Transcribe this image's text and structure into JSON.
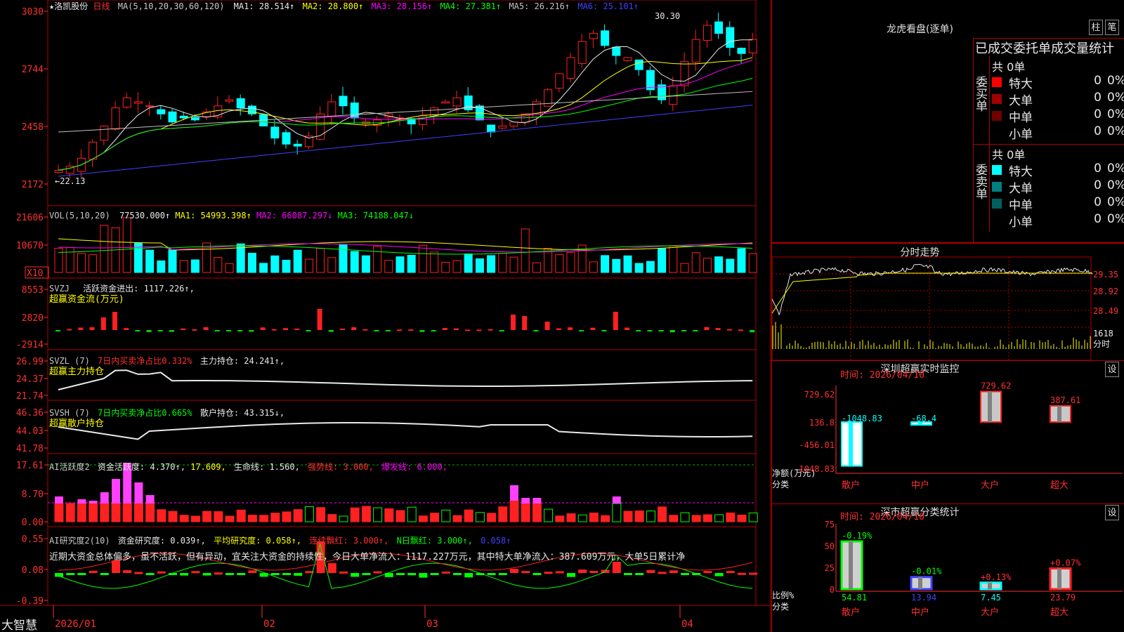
{
  "colors": {
    "up": "#ff2020",
    "down": "#00ffff",
    "grid": "#b00000",
    "axisText": "#ff3030"
  },
  "kline": {
    "name": "★洛凯股份",
    "period": "日线",
    "ma_spec": "MA(5,10,20,30,60,120)",
    "ma": [
      {
        "label": "MA1: 28.514↑",
        "color": "#e8e8e8"
      },
      {
        "label": "MA2: 28.800↑",
        "color": "#ffff00"
      },
      {
        "label": "MA3: 28.156↑",
        "color": "#ff00ff"
      },
      {
        "label": "MA4: 27.381↑",
        "color": "#00ff00"
      },
      {
        "label": "MA5: 26.216↑",
        "color": "#c0c0c0"
      },
      {
        "label": "MA6: 25.101↑",
        "color": "#4040ff"
      }
    ],
    "yticks": [
      "3030",
      "2744",
      "2458",
      "2172"
    ],
    "hi_label": "30.30",
    "lo_label": "←22.13"
  },
  "vol": {
    "title": "VOL(5,10,20)",
    "value": "77530.000↑",
    "ma": [
      {
        "label": "MA1: 54993.398↑",
        "color": "#ffff00"
      },
      {
        "label": "MA2: 66087.297↓",
        "color": "#ff00ff"
      },
      {
        "label": "MA3: 74188.047↓",
        "color": "#00ff00"
      }
    ],
    "yticks": [
      "21606",
      "10670"
    ],
    "unit": "X10"
  },
  "svzj": {
    "title": "SVZJ",
    "l1": "活跃资金进出: 1117.226↑,",
    "l2": "超赢资金流(万元)",
    "yticks": [
      "8553",
      "2820",
      "-2914"
    ]
  },
  "svzl": {
    "title": "SVZL (7)",
    "l1": "7日内买卖净占比0.332%",
    "l2": "主力持仓: 24.241↑,",
    "l3": "超赢主力持仓",
    "yticks": [
      "26.99",
      "24.37",
      "21.74"
    ]
  },
  "svsh": {
    "title": "SVSH (7)",
    "l1": "7日内买卖净占比0.665%",
    "l2": "散户持仓: 43.315↓,",
    "l3": "超赢散户持仓",
    "yticks": [
      "46.36",
      "44.03",
      "41.78"
    ]
  },
  "ai1": {
    "title": "AI活跃度2",
    "l1": "资金活跃度: 4.370↑,",
    "l2": "17.609,",
    "l3": "生命线: 1.560,",
    "l4": "强势线: 3.000,",
    "l5": "爆发线: 6.000,",
    "yticks": [
      "17.61",
      "8.70",
      "0.00"
    ]
  },
  "ai2": {
    "title": "AI研究度2(10)",
    "l1": "资金研究度: 0.039↑,",
    "l2": "平均研究度: 0.058↑,",
    "l3": "连续飘红: 3.000↑,",
    "l4": "N日飘红: 3.000↑,",
    "l5": "0.058↑",
    "comment": "近期大资金总体偏多，虽不活跃，但有异动，宜关注大资金的持续性，今日大单净流入：1117.227万元，其中特大单净流入：387.609万元，大单5日累计净",
    "yticks": [
      "0.55",
      "0.08",
      "-0.39"
    ]
  },
  "xaxis": {
    "labels": [
      "2026/01",
      "02",
      "03",
      "04"
    ],
    "brand": "大智慧"
  },
  "lhp": {
    "title": "龙虎看盘(逐单)",
    "btn1": "柱",
    "btn2": "笔",
    "subtitle": "已成交委托单成交量统计",
    "buy": {
      "label": "委买单",
      "total": "共 0单",
      "rows": [
        {
          "name": "特大",
          "count": "0",
          "pct": "0%",
          "color": "#ff0000"
        },
        {
          "name": "大单",
          "count": "0",
          "pct": "0%",
          "color": "#a00000"
        },
        {
          "name": "中单",
          "count": "0",
          "pct": "0%",
          "color": "#700000"
        },
        {
          "name": "小单",
          "count": "0",
          "pct": "0%",
          "color": "#000000"
        }
      ]
    },
    "sell": {
      "label": "委卖单",
      "total": "共 0单",
      "rows": [
        {
          "name": "特大",
          "count": "0",
          "pct": "0%",
          "color": "#00ffff"
        },
        {
          "name": "大单",
          "count": "0",
          "pct": "0%",
          "color": "#008080"
        },
        {
          "name": "中单",
          "count": "0",
          "pct": "0%",
          "color": "#006060"
        },
        {
          "name": "小单",
          "count": "0",
          "pct": "0%",
          "color": "#000000"
        }
      ]
    }
  },
  "intraday": {
    "title": "分时走势",
    "yticks": [
      "29.35",
      "28.92",
      "28.49"
    ],
    "vol_label": "1618",
    "vol_unit": "分时"
  },
  "monitor": {
    "title": "深圳超赢实时监控",
    "btn": "设",
    "time": "时间: 2026/04/10",
    "yticks": [
      "729.62",
      "136.8",
      "-456.01",
      "-1048.83"
    ],
    "ylabel": "净额(万元)",
    "xlabel": "分类",
    "bars": [
      {
        "cat": "散户",
        "value": -1048.83,
        "label": "-1048.83"
      },
      {
        "cat": "中户",
        "value": -68.4,
        "label": "-68.4"
      },
      {
        "cat": "大户",
        "value": 729.62,
        "label": "729.62"
      },
      {
        "cat": "超大",
        "value": 387.61,
        "label": "387.61"
      }
    ]
  },
  "classify": {
    "title": "深市超赢分类统计",
    "btn": "设",
    "time": "时间: 2026/04/10",
    "yticks": [
      "75",
      "50",
      "25",
      "0"
    ],
    "ylabel": "比例%",
    "xlabel": "分类",
    "bars": [
      {
        "cat": "散户",
        "value": 54.81,
        "chg": "-0.19%",
        "val": "54.81"
      },
      {
        "cat": "中户",
        "value": 13.94,
        "chg": "-0.01%",
        "val": "13.94"
      },
      {
        "cat": "大户",
        "value": 7.45,
        "chg": "+0.13%",
        "val": "7.45"
      },
      {
        "cat": "超大",
        "value": 23.79,
        "chg": "+0.07%",
        "val": "23.79"
      }
    ]
  }
}
